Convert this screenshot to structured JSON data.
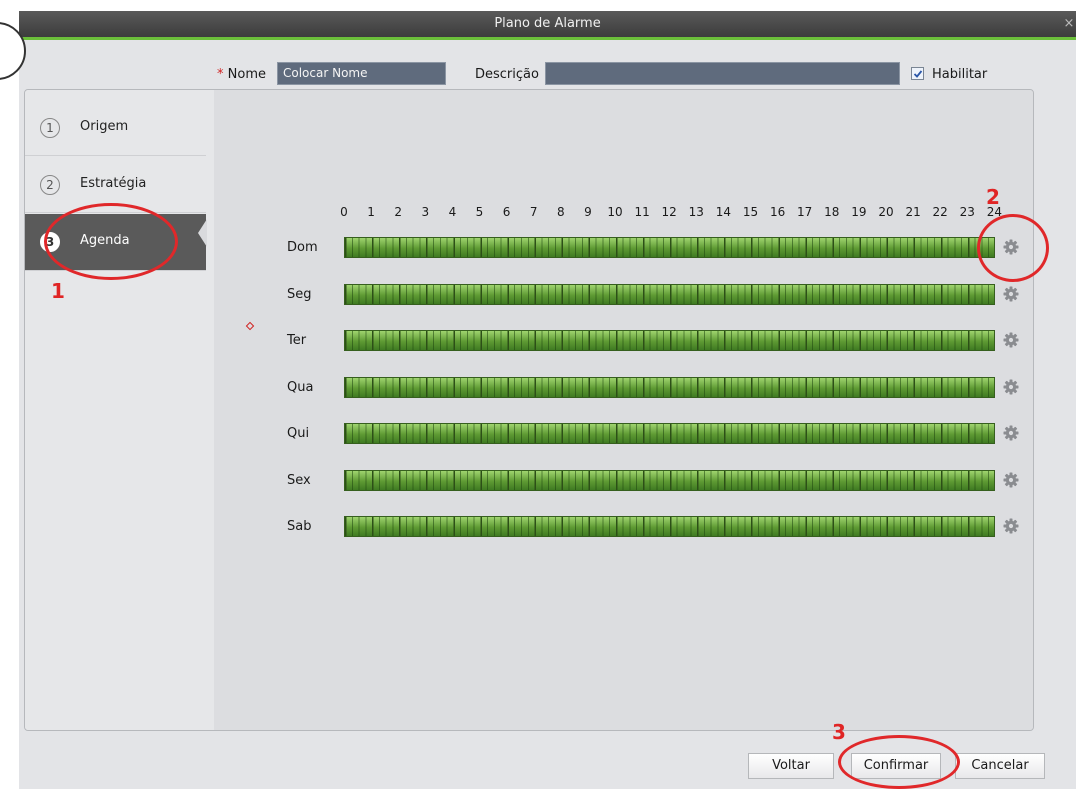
{
  "window": {
    "title": "Plano de Alarme",
    "close": "×"
  },
  "form": {
    "name_required_mark": "*",
    "name_label": "Nome",
    "name_value": "Colocar Nome",
    "desc_label": "Descrição",
    "desc_value": "",
    "enable_label": "Habilitar",
    "enable_checked": true
  },
  "steps": [
    {
      "num": "1",
      "label": "Origem",
      "active": false
    },
    {
      "num": "2",
      "label": "Estratégia",
      "active": false
    },
    {
      "num": "3",
      "label": "Agenda",
      "active": true
    }
  ],
  "schedule": {
    "hours": [
      "0",
      "1",
      "2",
      "3",
      "4",
      "5",
      "6",
      "7",
      "8",
      "9",
      "10",
      "11",
      "12",
      "13",
      "14",
      "15",
      "16",
      "17",
      "18",
      "19",
      "20",
      "21",
      "22",
      "23",
      "24"
    ],
    "days": [
      "Dom",
      "Seg",
      "Ter",
      "Qua",
      "Qui",
      "Sex",
      "Sab"
    ],
    "all_day_selected": true,
    "bar_color": "#6bb33e"
  },
  "buttons": {
    "back": "Voltar",
    "confirm": "Confirmar",
    "cancel": "Cancelar"
  },
  "annotations": {
    "n1": "1",
    "n2": "2",
    "n3": "3",
    "color": "#e0282a"
  }
}
